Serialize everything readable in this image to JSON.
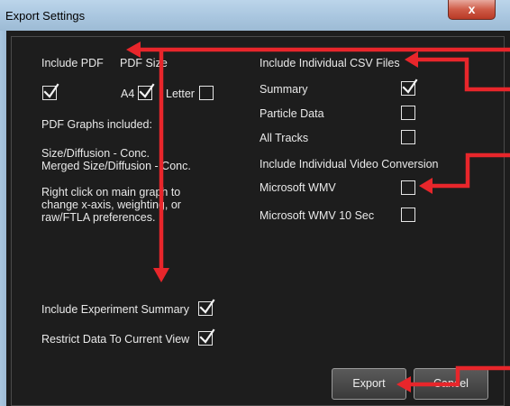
{
  "window": {
    "title": "Export Settings",
    "close_symbol": "x"
  },
  "left": {
    "include_pdf": "Include PDF",
    "pdf_size": "PDF Size",
    "a4": "A4",
    "letter": "Letter",
    "pdf_graphs": "PDF Graphs included:",
    "graphs_list": "Size/Diffusion - Conc.\nMerged Size/Diffusion - Conc.",
    "note": "Right click on main graph to\nchange x-axis, weighting, or\nraw/FTLA preferences.",
    "include_experiment_summary": "Include Experiment Summary",
    "restrict_data": "Restrict Data To Current View"
  },
  "right": {
    "csv_header": "Include Individual CSV Files",
    "summary": "Summary",
    "particle_data": "Particle Data",
    "all_tracks": "All Tracks",
    "video_header": "Include Individual Video Conversion",
    "wmv": "Microsoft WMV",
    "wmv10": "Microsoft WMV 10 Sec"
  },
  "checkboxes": {
    "include_pdf": true,
    "a4": true,
    "letter": false,
    "summary": true,
    "particle_data": false,
    "all_tracks": false,
    "wmv": false,
    "wmv10": false,
    "include_experiment_summary": true,
    "restrict_data": true
  },
  "buttons": {
    "export": "Export",
    "cancel": "Cancel"
  },
  "colors": {
    "background": "#1d1d1d",
    "text": "#e9e9e9",
    "annotation_arrow": "#e8262b"
  }
}
